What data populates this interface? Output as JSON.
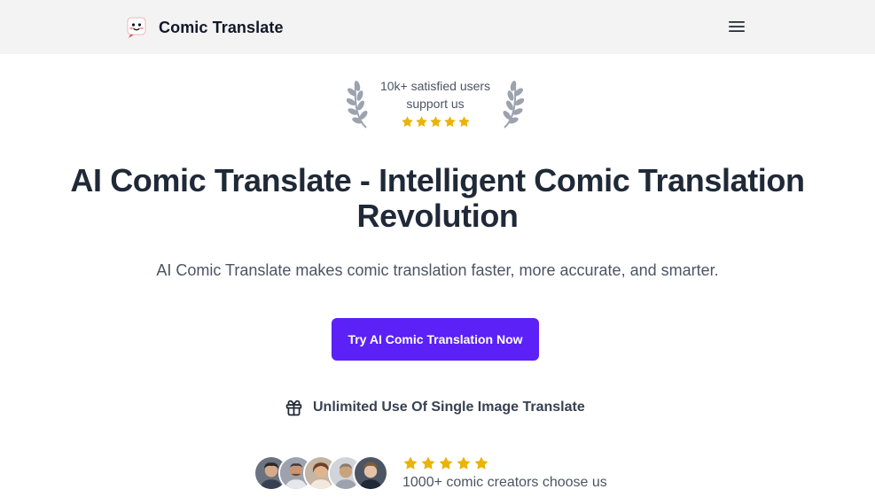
{
  "navbar": {
    "brand_name": "Comic Translate",
    "logo_icon": "comic-face-logo",
    "menu_icon": "hamburger-menu-icon"
  },
  "badge": {
    "line1": "10k+ satisfied users",
    "line2": "support us",
    "rating": 5,
    "star_color": "#eab308",
    "laurel_color": "#9ca3af"
  },
  "hero": {
    "headline_line1": "AI Comic Translate - Intelligent Comic Translation",
    "headline_line2": "Revolution",
    "subtitle": "AI Comic Translate makes comic translation faster, more accurate, and smarter.",
    "cta_label": "Try AI Comic Translation Now",
    "cta_color": "#5b21f6"
  },
  "feature": {
    "icon": "gift-icon",
    "label": "Unlimited Use Of Single Image Translate"
  },
  "social_proof": {
    "avatar_count": 5,
    "rating": 5,
    "label": "1000+ comic creators choose us"
  }
}
